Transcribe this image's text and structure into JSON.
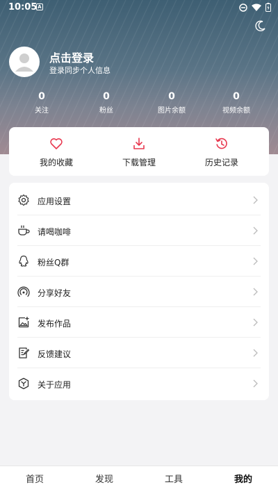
{
  "status_bar": {
    "time": "10:05",
    "notif_badge": "A"
  },
  "profile": {
    "login_title": "点击登录",
    "login_subtitle": "登录同步个人信息"
  },
  "stats": [
    {
      "value": "0",
      "label": "关注"
    },
    {
      "value": "0",
      "label": "粉丝"
    },
    {
      "value": "0",
      "label": "图片余额"
    },
    {
      "value": "0",
      "label": "视频余额"
    }
  ],
  "quick_actions": [
    {
      "label": "我的收藏",
      "icon": "heart-icon"
    },
    {
      "label": "下载管理",
      "icon": "download-icon"
    },
    {
      "label": "历史记录",
      "icon": "history-icon"
    }
  ],
  "menu": [
    {
      "label": "应用设置",
      "icon": "gear-icon"
    },
    {
      "label": "请喝咖啡",
      "icon": "coffee-icon"
    },
    {
      "label": "粉丝Q群",
      "icon": "qq-icon"
    },
    {
      "label": "分享好友",
      "icon": "share-signal-icon"
    },
    {
      "label": "发布作品",
      "icon": "image-upload-icon"
    },
    {
      "label": "反馈建议",
      "icon": "feedback-icon"
    },
    {
      "label": "关于应用",
      "icon": "cube-icon"
    }
  ],
  "bottom_nav": [
    {
      "label": "首页",
      "active": false
    },
    {
      "label": "发现",
      "active": false
    },
    {
      "label": "工具",
      "active": false
    },
    {
      "label": "我的",
      "active": true
    }
  ],
  "colors": {
    "accent": "#e8384f",
    "header_top": "#3e5f73",
    "header_bottom": "#a08a92"
  }
}
